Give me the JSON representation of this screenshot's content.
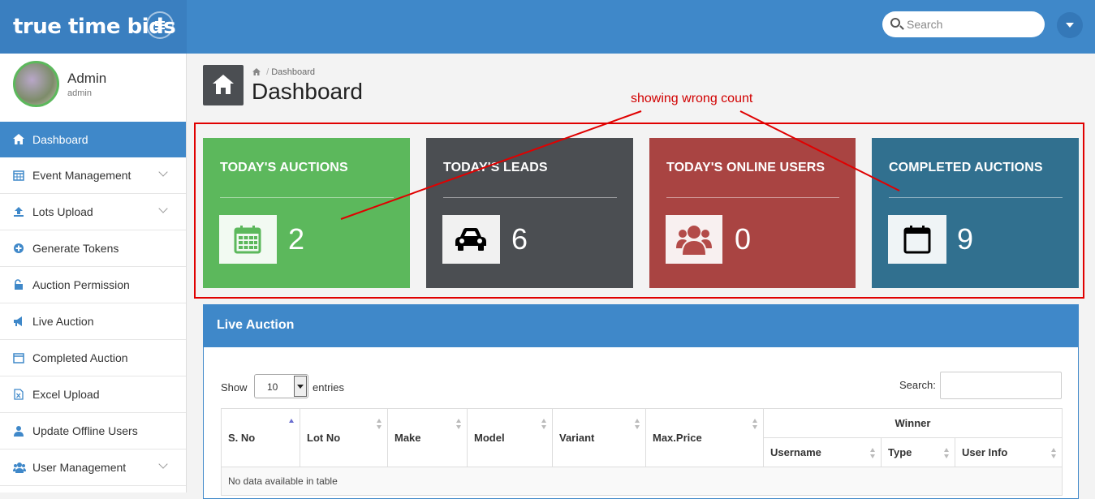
{
  "app": {
    "brand": "true time bids"
  },
  "topbar": {
    "search_placeholder": "Search"
  },
  "profile": {
    "name": "Admin",
    "role": "admin"
  },
  "sidebar": {
    "items": [
      {
        "label": "Dashboard",
        "icon": "home-icon",
        "active": true,
        "expandable": false
      },
      {
        "label": "Event Management",
        "icon": "calendar-icon",
        "active": false,
        "expandable": true
      },
      {
        "label": "Lots Upload",
        "icon": "upload-icon",
        "active": false,
        "expandable": true
      },
      {
        "label": "Generate Tokens",
        "icon": "plus-circle-icon",
        "active": false,
        "expandable": false
      },
      {
        "label": "Auction Permission",
        "icon": "unlock-icon",
        "active": false,
        "expandable": false
      },
      {
        "label": "Live Auction",
        "icon": "megaphone-icon",
        "active": false,
        "expandable": false
      },
      {
        "label": "Completed Auction",
        "icon": "calendar-icon",
        "active": false,
        "expandable": false
      },
      {
        "label": "Excel Upload",
        "icon": "excel-file-icon",
        "active": false,
        "expandable": false
      },
      {
        "label": "Update Offline Users",
        "icon": "user-icon",
        "active": false,
        "expandable": false
      },
      {
        "label": "User Management",
        "icon": "users-icon",
        "active": false,
        "expandable": true
      }
    ]
  },
  "header": {
    "breadcrumb": "Dashboard",
    "title": "Dashboard"
  },
  "annotation": {
    "text": "showing wrong count",
    "color": "#e00000"
  },
  "stats": [
    {
      "title": "TODAY'S AUCTIONS",
      "value": "2",
      "icon": "calendar-grid-icon",
      "color": "#5cb85c",
      "icon_color": "#5cb85c"
    },
    {
      "title": "TODAY'S LEADS",
      "value": "6",
      "icon": "car-icon",
      "color": "#4b4e52",
      "icon_color": "#000000"
    },
    {
      "title": "TODAY'S ONLINE USERS",
      "value": "0",
      "icon": "users-icon",
      "color": "#a94442",
      "icon_color": "#b34b49"
    },
    {
      "title": "COMPLETED AUCTIONS",
      "value": "9",
      "icon": "calendar-empty-icon",
      "color": "#31708f",
      "icon_color": "#000000"
    }
  ],
  "panel": {
    "title": "Live Auction",
    "show_label": "Show",
    "page_length": "10",
    "entries_label": "entries",
    "search_label": "Search:",
    "winner_group": "Winner",
    "columns": [
      "S. No",
      "Lot No",
      "Make",
      "Model",
      "Variant",
      "Max.Price"
    ],
    "winner_columns": [
      "Username",
      "Type",
      "User Info"
    ],
    "empty_message": "No data available in table"
  }
}
